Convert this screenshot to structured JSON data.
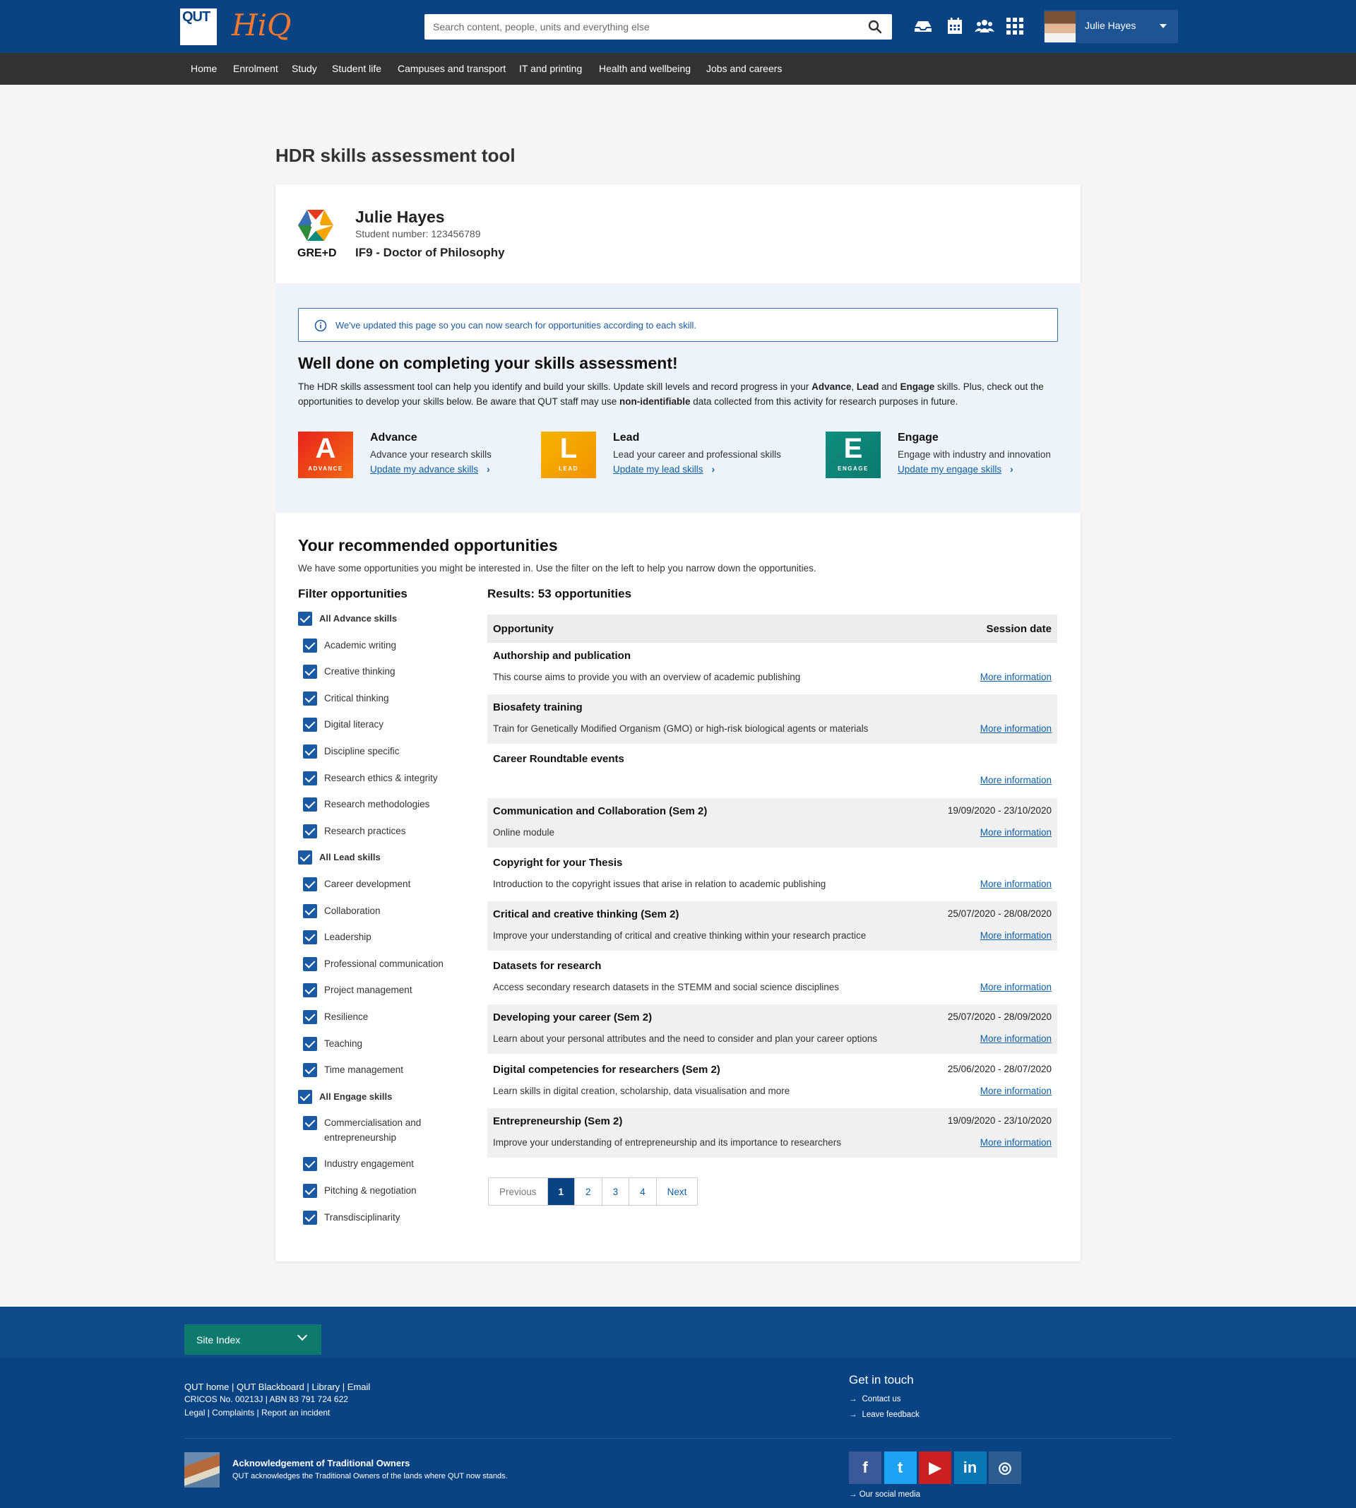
{
  "header": {
    "qut_logo": "QUT",
    "hiq_logo": "HiQ",
    "search_placeholder": "Search content, people, units and everything else",
    "user_name": "Julie Hayes"
  },
  "nav": [
    "Home",
    "Enrolment",
    "Study",
    "Student life",
    "Campuses and transport",
    "IT and printing",
    "Health and wellbeing",
    "Jobs and careers"
  ],
  "page_title": "HDR skills assessment tool",
  "profile": {
    "logo_text": "GRE+D",
    "name": "Julie Hayes",
    "student_number": "Student number: 123456789",
    "course": "IF9 - Doctor of Philosophy"
  },
  "alert": "We've updated this page so you can now search for opportunities according to each skill.",
  "assessment": {
    "heading": "Well done on completing your skills assessment!",
    "intro_1": "The HDR skills assessment tool can help you identify and build your skills. Update skill levels and record progress in your ",
    "intro_advance": "Advance",
    "intro_comma": ", ",
    "intro_lead": "Lead",
    "intro_and": " and ",
    "intro_engage": "Engage",
    "intro_2": " skills. Plus, check out the opportunities to develop your skills below. Be aware that QUT staff may use ",
    "intro_bold": "non-identifiable",
    "intro_3": " data collected from this activity for research purposes in future."
  },
  "skills": [
    {
      "letter": "A",
      "word": "ADVANCE",
      "title": "Advance",
      "desc": "Advance your research skills",
      "link": "Update my advance skills",
      "color": "#e8401c"
    },
    {
      "letter": "L",
      "word": "LEAD",
      "title": "Lead",
      "desc": "Lead your career and professional skills",
      "link": "Update my lead skills",
      "color": "#f5a000"
    },
    {
      "letter": "E",
      "word": "ENGAGE",
      "title": "Engage",
      "desc": "Engage with industry and innovation",
      "link": "Update my engage skills",
      "color": "#0e8a7c"
    }
  ],
  "opportunities": {
    "heading": "Your recommended opportunities",
    "intro": "We have some opportunities you might be interested in. Use the filter on the left to help you narrow down the opportunities.",
    "filter_heading": "Filter opportunities",
    "results_heading": "Results: 53 opportunities",
    "col_opportunity": "Opportunity",
    "col_session": "Session date",
    "more_label": "More information",
    "rows": [
      {
        "title": "Authorship and publication",
        "date": "",
        "desc": "This course aims to provide you with an overview of academic publishing"
      },
      {
        "title": "Biosafety training",
        "date": "",
        "desc": "Train for Genetically Modified Organism (GMO) or high-risk biological agents or materials"
      },
      {
        "title": "Career Roundtable events",
        "date": "",
        "desc": ""
      },
      {
        "title": "Communication and Collaboration (Sem 2)",
        "date": "19/09/2020 - 23/10/2020",
        "desc": "Online module"
      },
      {
        "title": "Copyright for your Thesis",
        "date": "",
        "desc": "Introduction to the copyright issues that arise in relation to academic publishing"
      },
      {
        "title": "Critical and creative thinking (Sem 2)",
        "date": "25/07/2020 - 28/08/2020",
        "desc": "Improve your understanding of critical and creative thinking within your research practice"
      },
      {
        "title": "Datasets for research",
        "date": "",
        "desc": "Access secondary research datasets in the STEMM and social science disciplines"
      },
      {
        "title": "Developing your career (Sem 2)",
        "date": "25/07/2020 - 28/09/2020",
        "desc": "Learn about your personal attributes and the need to consider and plan your career options"
      },
      {
        "title": "Digital competencies for researchers (Sem 2)",
        "date": "25/06/2020 - 28/07/2020",
        "desc": "Learn skills in digital creation, scholarship, data visualisation and more"
      },
      {
        "title": "Entrepreneurship (Sem 2)",
        "date": "19/09/2020 - 23/10/2020",
        "desc": "Improve your understanding of entrepreneurship and its importance to researchers"
      }
    ],
    "pagination": [
      "Previous",
      "1",
      "2",
      "3",
      "4",
      "Next"
    ]
  },
  "filters": [
    {
      "label": "All Advance skills",
      "group": true,
      "checked": true
    },
    {
      "label": "Academic writing",
      "group": false,
      "checked": true
    },
    {
      "label": "Creative thinking",
      "group": false,
      "checked": true
    },
    {
      "label": "Critical thinking",
      "group": false,
      "checked": true
    },
    {
      "label": "Digital literacy",
      "group": false,
      "checked": true
    },
    {
      "label": "Discipline specific",
      "group": false,
      "checked": true
    },
    {
      "label": "Research ethics & integrity",
      "group": false,
      "checked": true
    },
    {
      "label": "Research methodologies",
      "group": false,
      "checked": true
    },
    {
      "label": "Research practices",
      "group": false,
      "checked": true
    },
    {
      "label": "All Lead skills",
      "group": true,
      "checked": true
    },
    {
      "label": "Career development",
      "group": false,
      "checked": true
    },
    {
      "label": "Collaboration",
      "group": false,
      "checked": true
    },
    {
      "label": "Leadership",
      "group": false,
      "checked": true
    },
    {
      "label": "Professional communication",
      "group": false,
      "checked": true
    },
    {
      "label": "Project management",
      "group": false,
      "checked": true
    },
    {
      "label": "Resilience",
      "group": false,
      "checked": true
    },
    {
      "label": "Teaching",
      "group": false,
      "checked": true
    },
    {
      "label": "Time management",
      "group": false,
      "checked": true
    },
    {
      "label": "All Engage skills",
      "group": true,
      "checked": true
    },
    {
      "label": "Commercialisation and",
      "label2": "entrepreneurship",
      "group": false,
      "checked": true
    },
    {
      "label": "Industry engagement",
      "group": false,
      "checked": true
    },
    {
      "label": "Pitching & negotiation",
      "group": false,
      "checked": true
    },
    {
      "label": "Transdisciplinarity",
      "group": false,
      "checked": true
    }
  ],
  "footer": {
    "site_index": "Site Index",
    "links_row1": [
      "QUT home",
      "QUT Blackboard",
      "Library",
      "Email"
    ],
    "cricos": "CRICOS No. 00213J",
    "abn": "ABN 83 791 724 622",
    "links_row3": [
      "Legal",
      "Complaints",
      "Report an incident"
    ],
    "get_in_touch": "Get in touch",
    "contact_us": "Contact us",
    "leave_feedback": "Leave feedback",
    "ack_title": "Acknowledgement of Traditional Owners",
    "ack_text": "QUT acknowledges the Traditional Owners of the lands where QUT now stands.",
    "social_label": "Our social media",
    "social": [
      {
        "icon": "facebook-icon",
        "glyph": "f",
        "color": "#3b5998"
      },
      {
        "icon": "twitter-icon",
        "glyph": "t",
        "color": "#1da1f2"
      },
      {
        "icon": "youtube-icon",
        "glyph": "▶",
        "color": "#cc1f1f"
      },
      {
        "icon": "linkedin-icon",
        "glyph": "in",
        "color": "#0a77b5"
      },
      {
        "icon": "instagram-icon",
        "glyph": "◎",
        "color": "#2b5d91"
      }
    ]
  }
}
